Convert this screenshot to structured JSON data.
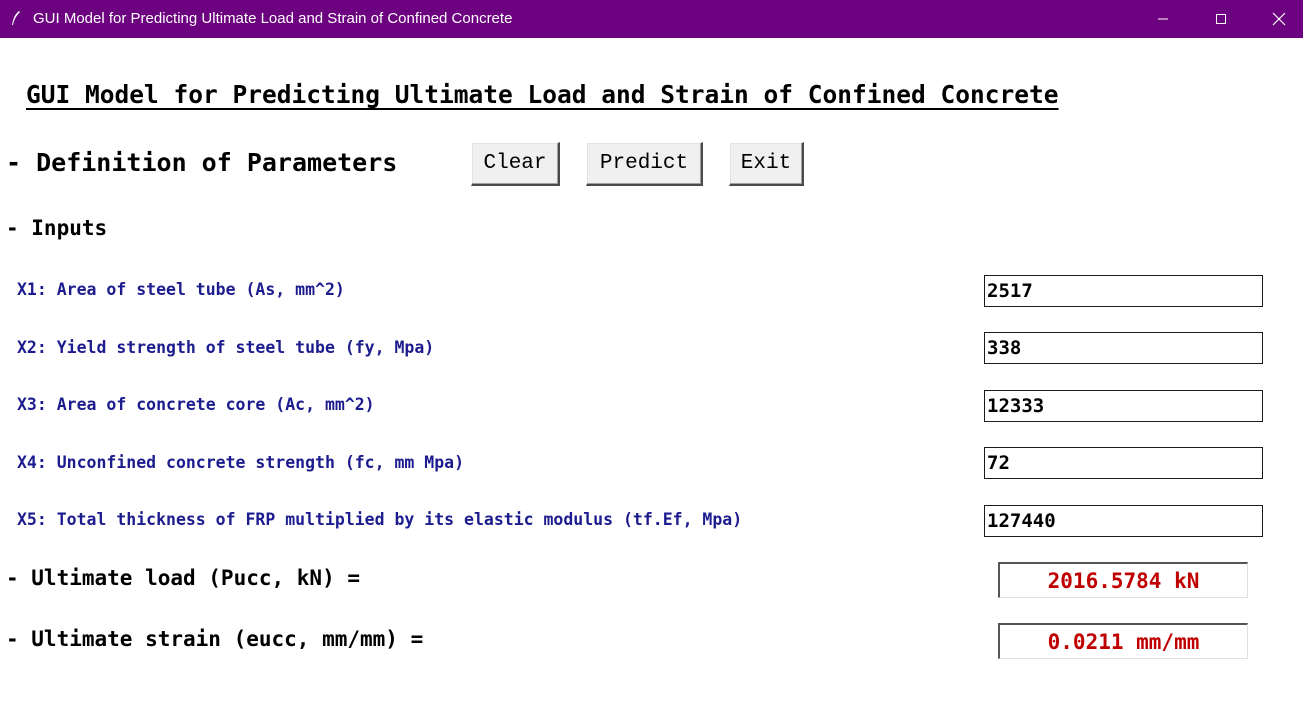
{
  "window": {
    "title": "GUI Model for Predicting Ultimate Load and Strain of Confined Concrete",
    "controls": [
      "minimize-icon",
      "maximize-icon",
      "close-icon"
    ]
  },
  "heading": "GUI Model for Predicting Ultimate Load and Strain of Confined Concrete",
  "definition_section": "- Definition of Parameters",
  "buttons": {
    "clear": "Clear",
    "predict": "Predict",
    "exit": "Exit"
  },
  "inputs_section": "- Inputs",
  "parameters": [
    {
      "label": "X1: Area of steel tube (As, mm^2)",
      "value": "2517"
    },
    {
      "label": "X2: Yield strength of steel tube (fy, Mpa)",
      "value": "338"
    },
    {
      "label": "X3: Area of concrete core (Ac, mm^2)",
      "value": "12333"
    },
    {
      "label": "X4: Unconfined concrete strength (fc, mm Mpa)",
      "value": "72"
    },
    {
      "label": "X5: Total thickness of FRP multiplied by its elastic modulus (tf.Ef, Mpa)",
      "value": "127440"
    }
  ],
  "results": {
    "load_label": "- Ultimate load (Pucc, kN) =",
    "load_value": "2016.5784 kN",
    "strain_label": "- Ultimate strain (eucc, mm/mm) =",
    "strain_value": "0.0211 mm/mm"
  },
  "colors": {
    "titlebar": "#6c027f",
    "param_label": "#1c1c8f",
    "result_value": "#c00000"
  }
}
